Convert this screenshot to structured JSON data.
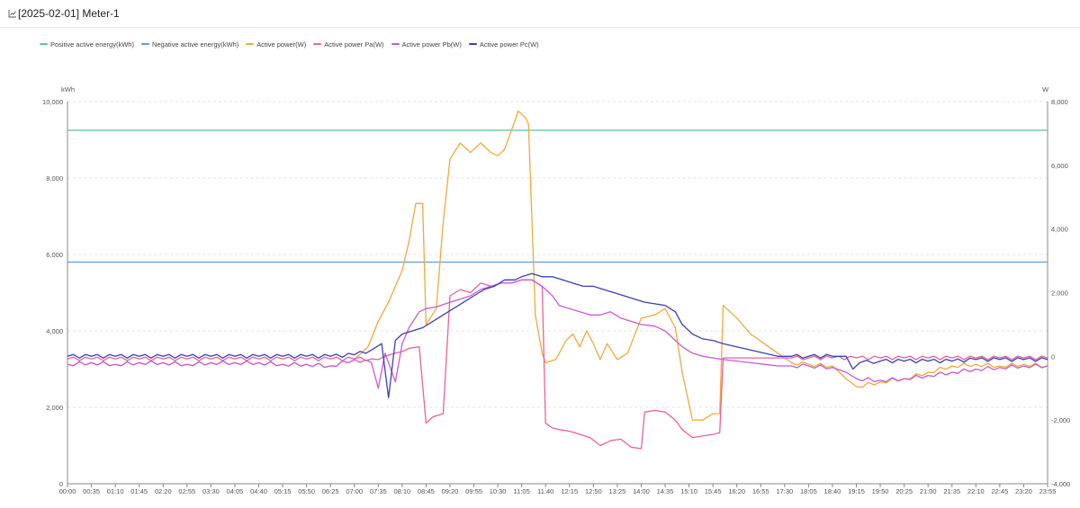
{
  "header": {
    "title": "[2025-02-01] Meter-1",
    "icon": "line-chart-icon"
  },
  "legend": [
    {
      "label": "Positive active energy(kWh)",
      "color": "#52c69b"
    },
    {
      "label": "Negative active energy(kWh)",
      "color": "#5b9ee6"
    },
    {
      "label": "Active power(W)",
      "color": "#f2a93b"
    },
    {
      "label": "Active power Pa(W)",
      "color": "#e9629a"
    },
    {
      "label": "Active power Pb(W)",
      "color": "#c95ad6"
    },
    {
      "label": "Active power Pc(W)",
      "color": "#3c3fb8"
    }
  ],
  "chart_data": {
    "type": "line",
    "title": "[2025-02-01] Meter-1",
    "y_left": {
      "unit": "kWh",
      "range": [
        0,
        10000
      ],
      "ticks": [
        "0",
        "2,000",
        "4,000",
        "6,000",
        "8,000",
        "10,000"
      ]
    },
    "y_right": {
      "unit": "W",
      "range": [
        -4000,
        8000
      ],
      "ticks": [
        "-4,000",
        "-2,000",
        "0",
        "2,000",
        "4,000",
        "6,000",
        "8,000"
      ]
    },
    "x_ticks": [
      "00:00",
      "00:35",
      "01:10",
      "01:45",
      "02:20",
      "02:55",
      "03:30",
      "04:05",
      "04:40",
      "05:15",
      "05:50",
      "06:25",
      "07:00",
      "07:35",
      "08:10",
      "08:45",
      "09:20",
      "09:55",
      "10:30",
      "11:05",
      "11:40",
      "12:15",
      "12:50",
      "13:25",
      "14:00",
      "14:35",
      "15:10",
      "15:45",
      "16:20",
      "16:55",
      "17:30",
      "18:05",
      "18:40",
      "19:15",
      "19:50",
      "20:25",
      "21:00",
      "21:35",
      "22:10",
      "22:45",
      "23:20",
      "23:55"
    ],
    "grid": true,
    "legend_position": "top-left",
    "series": [
      {
        "name": "Positive active energy(kWh)",
        "axis": "left",
        "color": "#52c69b",
        "x": [
          "00:00",
          "23:55"
        ],
        "y": [
          9250,
          9250
        ]
      },
      {
        "name": "Negative active energy(kWh)",
        "axis": "left",
        "color": "#5b9ee6",
        "x": [
          "00:00",
          "23:55"
        ],
        "y": [
          5800,
          5800
        ]
      },
      {
        "name": "Active power(W)",
        "axis": "right",
        "color": "#f2a93b",
        "x": [
          "00:00",
          "00:35",
          "01:10",
          "01:45",
          "02:20",
          "02:55",
          "03:30",
          "04:05",
          "04:40",
          "05:15",
          "05:50",
          "06:25",
          "07:00",
          "07:20",
          "07:35",
          "07:50",
          "08:00",
          "08:10",
          "08:20",
          "08:30",
          "08:40",
          "08:45",
          "09:00",
          "09:10",
          "09:20",
          "09:35",
          "09:50",
          "10:05",
          "10:20",
          "10:30",
          "10:40",
          "10:50",
          "11:00",
          "11:10",
          "11:15",
          "11:25",
          "11:35",
          "11:40",
          "11:55",
          "12:10",
          "12:20",
          "12:30",
          "12:40",
          "12:50",
          "13:00",
          "13:10",
          "13:25",
          "13:40",
          "14:00",
          "14:20",
          "14:35",
          "14:50",
          "15:00",
          "15:15",
          "15:30",
          "15:45",
          "15:55",
          "16:00",
          "16:20",
          "16:40",
          "17:00",
          "17:20",
          "17:40",
          "18:05",
          "18:40",
          "19:00",
          "19:15",
          "19:50",
          "20:25",
          "21:00",
          "21:35",
          "22:10",
          "22:45",
          "23:20",
          "23:55"
        ],
        "y": [
          -250,
          -200,
          -250,
          -200,
          -200,
          -250,
          -200,
          -200,
          -200,
          -250,
          -250,
          -300,
          -100,
          300,
          1100,
          1700,
          2200,
          2700,
          3600,
          4800,
          4800,
          1000,
          1500,
          4200,
          6200,
          6700,
          6400,
          6700,
          6400,
          6300,
          6500,
          7100,
          7700,
          7500,
          7300,
          1300,
          100,
          -200,
          -100,
          500,
          700,
          300,
          800,
          400,
          -100,
          400,
          -100,
          100,
          1200,
          1300,
          1500,
          900,
          -500,
          -2000,
          -2000,
          -1800,
          -1800,
          1600,
          1200,
          700,
          400,
          100,
          -200,
          -250,
          -300,
          -700,
          -950,
          -800,
          -700,
          -500,
          -300,
          -250,
          -300,
          -250,
          -300
        ]
      },
      {
        "name": "Active power Pa(W)",
        "axis": "right",
        "color": "#e9629a",
        "x": [
          "00:00",
          "00:35",
          "01:10",
          "01:45",
          "02:20",
          "02:55",
          "03:30",
          "04:05",
          "04:40",
          "05:15",
          "05:50",
          "06:25",
          "07:00",
          "07:25",
          "07:35",
          "07:45",
          "08:00",
          "08:10",
          "08:20",
          "08:35",
          "08:45",
          "08:55",
          "09:10",
          "09:20",
          "09:35",
          "09:50",
          "10:05",
          "10:20",
          "10:35",
          "10:50",
          "11:05",
          "11:20",
          "11:35",
          "11:40",
          "11:50",
          "12:00",
          "12:15",
          "12:30",
          "12:45",
          "13:00",
          "13:15",
          "13:30",
          "13:45",
          "14:00",
          "14:05",
          "14:20",
          "14:35",
          "14:50",
          "15:00",
          "15:15",
          "15:30",
          "15:45",
          "15:55",
          "16:00",
          "16:20",
          "16:40",
          "17:00",
          "17:20",
          "17:40",
          "18:05",
          "18:40",
          "19:15",
          "19:50",
          "20:25",
          "21:00",
          "21:35",
          "22:10",
          "22:45",
          "23:20",
          "23:55"
        ],
        "y": [
          -80,
          -80,
          -80,
          -80,
          -80,
          -80,
          -80,
          -80,
          -80,
          -80,
          -80,
          -80,
          -80,
          -80,
          -100,
          0,
          100,
          150,
          250,
          300,
          -2100,
          -1900,
          -1800,
          1900,
          2100,
          2000,
          2300,
          2200,
          2300,
          2300,
          2400,
          2400,
          2200,
          -2100,
          -2250,
          -2300,
          -2350,
          -2450,
          -2550,
          -2800,
          -2650,
          -2600,
          -2850,
          -2900,
          -1750,
          -1700,
          -1750,
          -2000,
          -2300,
          -2550,
          -2500,
          -2450,
          -2400,
          -50,
          -50,
          -50,
          -50,
          -50,
          -50,
          -50,
          -50,
          -50,
          -50,
          -50,
          -50,
          -50,
          -50,
          -50,
          -50,
          -50
        ]
      },
      {
        "name": "Active power Pb(W)",
        "axis": "right",
        "color": "#c95ad6",
        "x": [
          "00:00",
          "00:35",
          "01:10",
          "01:45",
          "02:20",
          "02:55",
          "03:30",
          "04:05",
          "04:40",
          "05:15",
          "05:50",
          "06:25",
          "07:00",
          "07:25",
          "07:35",
          "07:45",
          "08:00",
          "08:10",
          "08:20",
          "08:35",
          "08:45",
          "09:00",
          "09:20",
          "09:35",
          "09:50",
          "10:05",
          "10:20",
          "10:35",
          "10:50",
          "11:05",
          "11:20",
          "11:35",
          "11:50",
          "12:00",
          "12:15",
          "12:30",
          "12:45",
          "13:00",
          "13:15",
          "13:30",
          "13:45",
          "14:00",
          "14:20",
          "14:35",
          "14:50",
          "15:00",
          "15:15",
          "15:30",
          "15:45",
          "16:00",
          "16:20",
          "16:40",
          "17:00",
          "17:20",
          "17:40",
          "18:05",
          "18:40",
          "19:00",
          "19:15",
          "19:50",
          "20:25",
          "21:00",
          "21:35",
          "22:10",
          "22:45",
          "23:20",
          "23:55"
        ],
        "y": [
          -250,
          -200,
          -250,
          -200,
          -200,
          -250,
          -200,
          -200,
          -200,
          -250,
          -250,
          -300,
          -100,
          -200,
          -1000,
          100,
          -800,
          400,
          900,
          1400,
          1500,
          1550,
          1700,
          1800,
          1900,
          2100,
          2200,
          2300,
          2300,
          2400,
          2400,
          2200,
          1900,
          1600,
          1500,
          1400,
          1300,
          1300,
          1400,
          1200,
          1100,
          1000,
          950,
          800,
          500,
          300,
          100,
          0,
          -50,
          -100,
          -150,
          -200,
          -250,
          -300,
          -300,
          -300,
          -350,
          -500,
          -700,
          -750,
          -700,
          -600,
          -500,
          -400,
          -350,
          -300,
          -300
        ]
      },
      {
        "name": "Active power Pc(W)",
        "axis": "right",
        "color": "#3c3fb8",
        "x": [
          "00:00",
          "00:35",
          "01:10",
          "01:45",
          "02:20",
          "02:55",
          "03:30",
          "04:05",
          "04:40",
          "05:15",
          "05:50",
          "06:25",
          "07:00",
          "07:25",
          "07:40",
          "07:50",
          "08:00",
          "08:10",
          "08:25",
          "08:40",
          "08:55",
          "09:10",
          "09:25",
          "09:40",
          "09:55",
          "10:10",
          "10:25",
          "10:40",
          "10:55",
          "11:05",
          "11:20",
          "11:35",
          "11:50",
          "12:05",
          "12:20",
          "12:35",
          "12:50",
          "13:05",
          "13:20",
          "13:35",
          "13:50",
          "14:05",
          "14:20",
          "14:35",
          "14:50",
          "15:00",
          "15:15",
          "15:30",
          "15:45",
          "16:00",
          "16:20",
          "16:40",
          "17:00",
          "17:20",
          "17:40",
          "18:05",
          "18:40",
          "19:00",
          "19:10",
          "19:20",
          "19:50",
          "20:25",
          "21:00",
          "21:35",
          "22:10",
          "22:45",
          "23:20",
          "23:55"
        ],
        "y": [
          0,
          0,
          0,
          0,
          0,
          0,
          0,
          0,
          0,
          0,
          0,
          0,
          50,
          200,
          400,
          -1300,
          500,
          700,
          800,
          900,
          1100,
          1300,
          1500,
          1700,
          1900,
          2100,
          2200,
          2400,
          2400,
          2500,
          2600,
          2500,
          2500,
          2400,
          2300,
          2200,
          2200,
          2100,
          2000,
          1900,
          1800,
          1700,
          1650,
          1600,
          1400,
          1000,
          700,
          550,
          500,
          400,
          300,
          200,
          100,
          0,
          0,
          0,
          0,
          0,
          -400,
          -200,
          -150,
          -150,
          -150,
          -150,
          -100,
          -100,
          -100,
          -100
        ]
      }
    ]
  }
}
